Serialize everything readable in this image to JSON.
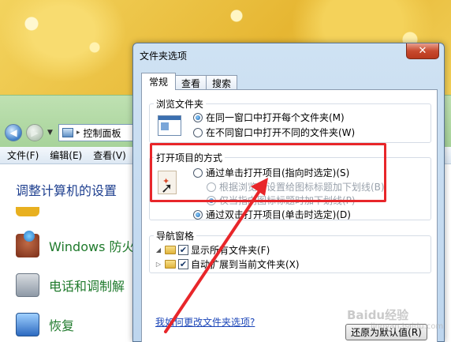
{
  "explorer": {
    "address_path": "控制面板",
    "menu": [
      "文件(F)",
      "编辑(E)",
      "查看(V)"
    ],
    "heading": "调整计算机的设置",
    "items": [
      {
        "label": "Windows 防火",
        "icon": "firewall-icon"
      },
      {
        "label": "电话和调制解",
        "icon": "phone-modem-icon"
      },
      {
        "label": "恢复",
        "icon": "recovery-icon"
      }
    ]
  },
  "dialog": {
    "title": "文件夹选项",
    "close_glyph": "✕",
    "tabs": [
      "常规",
      "查看",
      "搜索"
    ],
    "browse_group": {
      "label": "浏览文件夹",
      "options": [
        "在同一窗口中打开每个文件夹(M)",
        "在不同窗口中打开不同的文件夹(W)"
      ],
      "selected_index": 0
    },
    "click_group": {
      "label": "打开项目的方式",
      "single_click": "通过单击打开项目(指向时选定)(S)",
      "underline_browser": "根据浏览器设置给图标标题加下划线(B)",
      "underline_point": "仅当指向图标标题时加下划线(P)",
      "double_click": "通过双击打开项目(单击时选定)(D)",
      "selected": "double_click"
    },
    "nav_group": {
      "label": "导航窗格",
      "checks": [
        {
          "label": "显示所有文件夹(F)",
          "checked": true
        },
        {
          "label": "自动扩展到当前文件夹(X)",
          "checked": true
        }
      ]
    },
    "restore_button": "还原为默认值(R)",
    "help_link": "我如何更改文件夹选项?"
  },
  "annotation": {
    "color": "#e8262a"
  },
  "watermark": {
    "text": "Baidu经验",
    "sub": "jingyan.baidu.com"
  }
}
